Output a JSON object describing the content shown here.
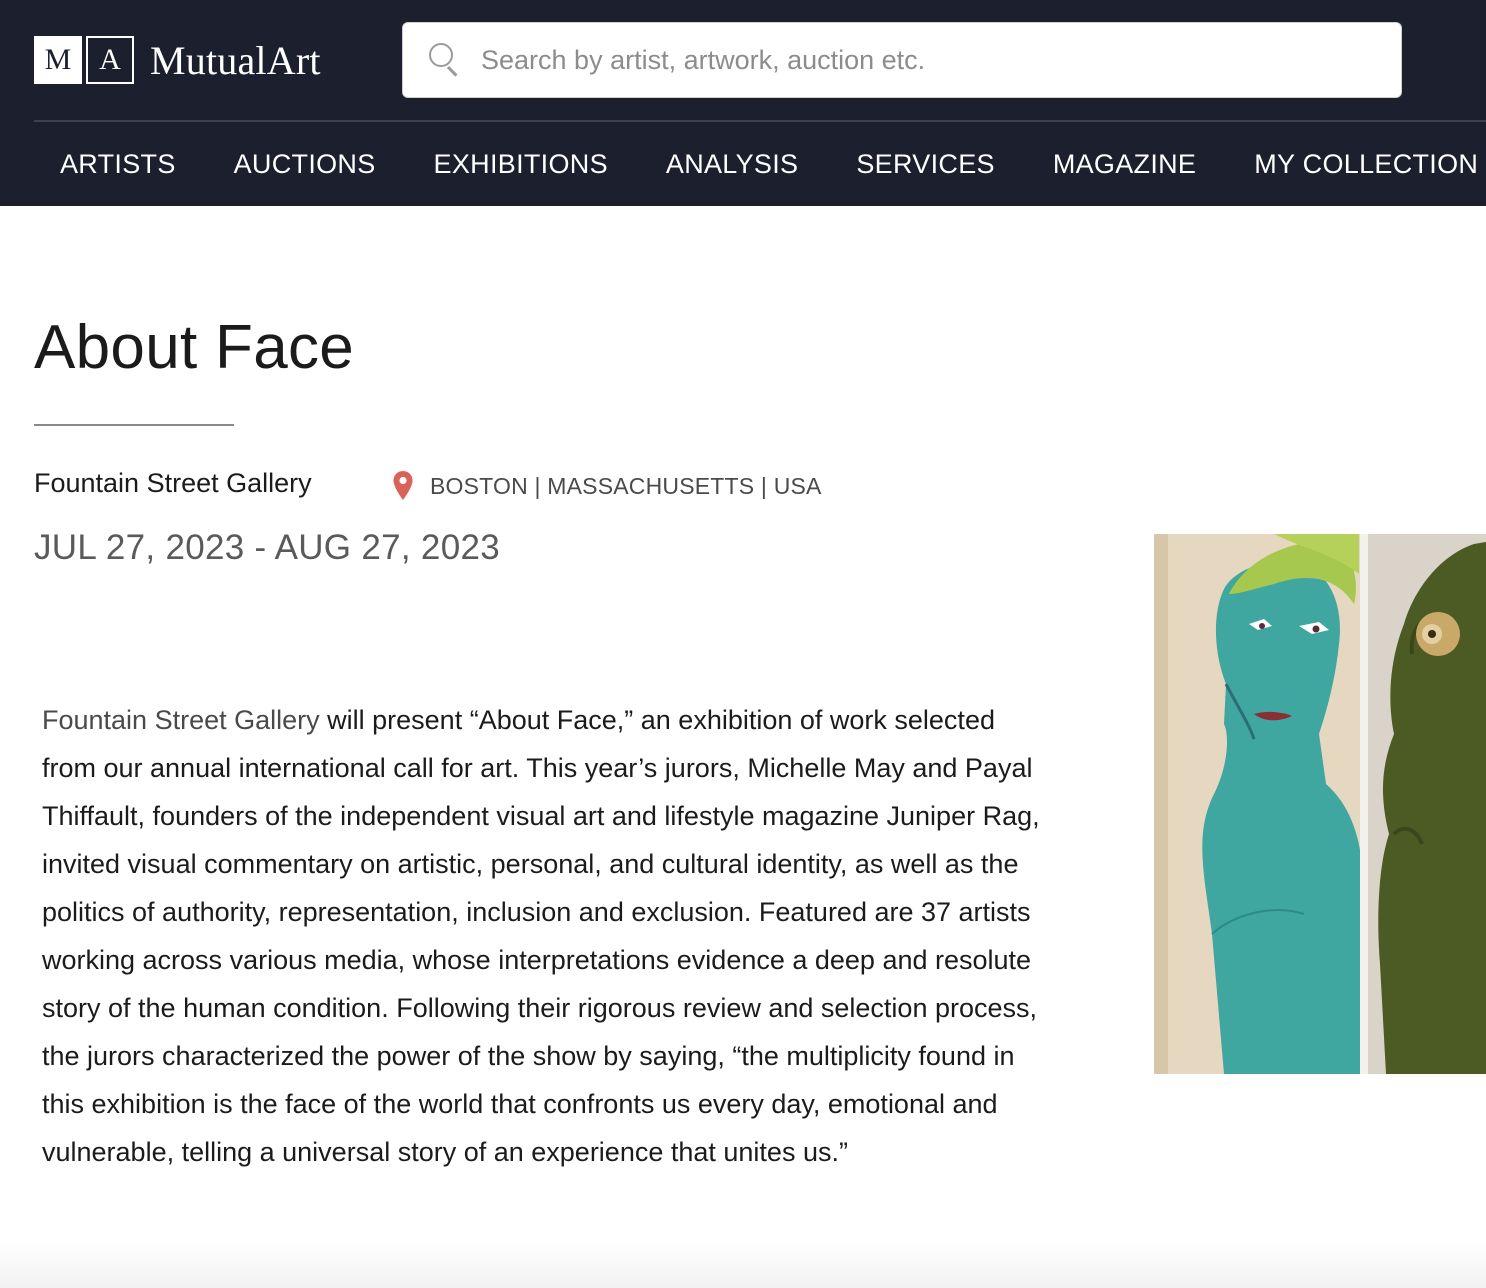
{
  "header": {
    "logo": {
      "letter_1": "M",
      "letter_2": "A",
      "name": "MutualArt"
    },
    "search": {
      "placeholder": "Search by artist, artwork, auction etc.",
      "value": ""
    },
    "nav": [
      {
        "label": "ARTISTS"
      },
      {
        "label": "AUCTIONS"
      },
      {
        "label": "EXHIBITIONS"
      },
      {
        "label": "ANALYSIS"
      },
      {
        "label": "SERVICES"
      },
      {
        "label": "MAGAZINE"
      },
      {
        "label": "MY COLLECTION"
      }
    ]
  },
  "exhibition": {
    "title": "About Face",
    "gallery": "Fountain Street Gallery",
    "location": "BOSTON | MASSACHUSETTS | USA",
    "dates": "JUL 27, 2023 - AUG 27, 2023",
    "description_link": "Fountain Street Gallery",
    "description": " will present “About Face,” an exhibition of work selected from our annual international call for art. This year’s jurors, Michelle May and Payal Thiffault, founders of the independent visual art and lifestyle magazine Juniper Rag, invited visual commentary on artistic, personal, and cultural identity, as well as the politics of authority, representation, inclusion and exclusion. Featured are 37 artists working across various media, whose interpretations evidence a deep and resolute story of the human condition. Following their rigorous review and selection process, the jurors characterized the power of the show by saying, “the multiplicity found in this exhibition is the face of the world that confronts us every day, emotional and vulnerable, telling a universal story of an experience that unites us.”"
  },
  "colors": {
    "header_bg": "#1c1f2e",
    "pin": "#d9625a",
    "text": "#1b1b1b",
    "muted": "#5a5a5a"
  },
  "icons": [
    "search-icon",
    "location-pin-icon"
  ]
}
